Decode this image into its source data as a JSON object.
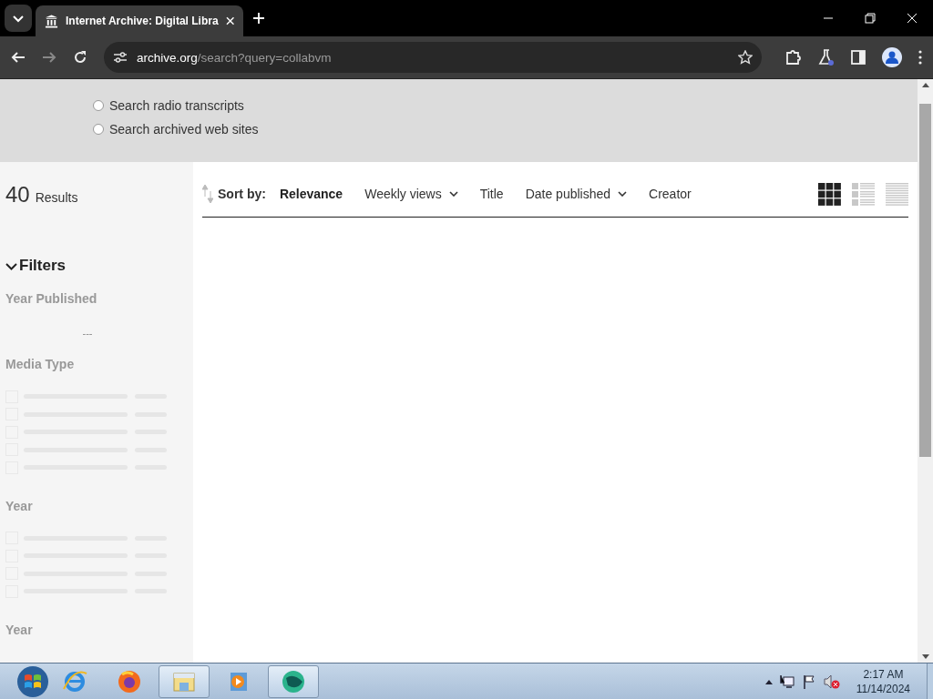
{
  "browser": {
    "tab": {
      "title": "Internet Archive: Digital Libra",
      "selected": true
    },
    "address": {
      "host": "archive.org",
      "path": "/search?query=collabvm"
    }
  },
  "search_options": [
    {
      "label": "Search radio transcripts",
      "selected": false
    },
    {
      "label": "Search archived web sites",
      "selected": false
    }
  ],
  "results": {
    "count": "40",
    "label": "Results"
  },
  "filters": {
    "title": "Filters",
    "expanded": true,
    "year_published": "Year Published",
    "loading_mark": "---",
    "facets": [
      {
        "title": "Media Type",
        "rows": [
          {
            "kind": "loading"
          },
          {
            "kind": "loading"
          },
          {
            "kind": "loading"
          },
          {
            "kind": "loading"
          },
          {
            "kind": "loading"
          }
        ]
      },
      {
        "title": "Year",
        "rows": [
          {
            "kind": "loading"
          },
          {
            "kind": "loading"
          },
          {
            "kind": "loading"
          },
          {
            "kind": "loading"
          }
        ]
      },
      {
        "title": "Year"
      }
    ]
  },
  "sort": {
    "label": "Sort by:",
    "options": [
      {
        "label": "Relevance",
        "kind": "plain",
        "selected": true
      },
      {
        "label": "Weekly views",
        "kind": "dropdown",
        "selected": false
      },
      {
        "label": "Title",
        "kind": "plain",
        "selected": false
      },
      {
        "label": "Date published",
        "kind": "dropdown",
        "selected": false
      },
      {
        "label": "Creator",
        "kind": "plain",
        "selected": false
      }
    ],
    "views": [
      {
        "kind": "grid",
        "selected": true
      },
      {
        "kind": "list",
        "selected": false
      },
      {
        "kind": "compact",
        "selected": false
      }
    ]
  },
  "taskbar": {
    "apps": [
      {
        "kind": "ie",
        "selected": false
      },
      {
        "kind": "firefox",
        "selected": false
      },
      {
        "kind": "explorer",
        "selected": true
      },
      {
        "kind": "media",
        "selected": false
      },
      {
        "kind": "collab",
        "selected": true
      }
    ],
    "time": "2:17 AM",
    "date": "11/14/2024"
  }
}
